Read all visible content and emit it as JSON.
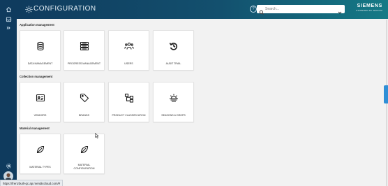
{
  "header": {
    "title": "CONFIGURATION",
    "search_placeholder": "Search...",
    "brand": "SIEMENS",
    "brand_sub": "POWERED BY MOXOM",
    "help_symbol": "?"
  },
  "sections": [
    {
      "title": "Application management",
      "cards": [
        {
          "label": "DATA MANAGEMENT",
          "icon": "database-icon"
        },
        {
          "label": "PROGRESS MANAGEMENT",
          "icon": "server-stack-icon"
        },
        {
          "label": "USERS",
          "icon": "users-icon"
        },
        {
          "label": "AUDIT TRAIL",
          "icon": "history-icon"
        }
      ]
    },
    {
      "title": "Collection management",
      "cards": [
        {
          "label": "VENDORS",
          "icon": "id-card-icon"
        },
        {
          "label": "BRANDS",
          "icon": "tag-icon"
        },
        {
          "label": "PRODUCT CLASSIFICATION",
          "icon": "hierarchy-icon"
        },
        {
          "label": "SEASONS & DROPS",
          "icon": "sunset-icon"
        }
      ]
    },
    {
      "title": "Material management",
      "cards": [
        {
          "label": "MATERIAL TYPES",
          "icon": "leaf-icon"
        },
        {
          "label": "MATERIAL CONFIGURATION",
          "icon": "leaf-icon"
        }
      ]
    }
  ],
  "status_url": "https://frenzbuilt-qc.ap.mendixcloud.com/#",
  "colors": {
    "rail": "#0f3b5e",
    "header_end": "#157a86",
    "accent": "#2f8fd6"
  }
}
